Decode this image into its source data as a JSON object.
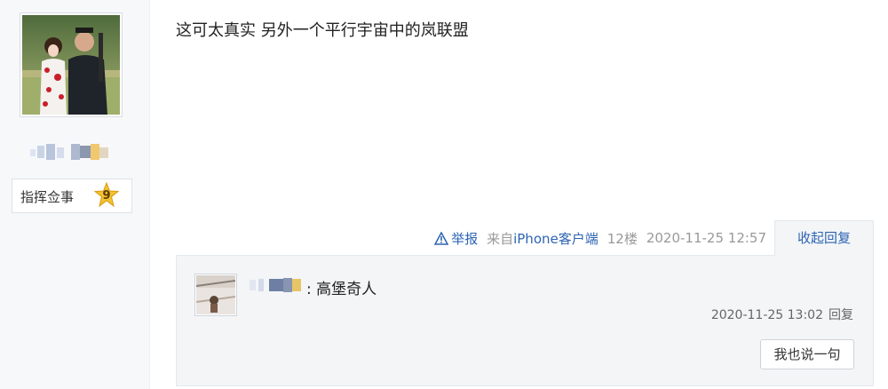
{
  "author": {
    "avatar_icon": "user-avatar-photo",
    "level_title": "指挥佥事",
    "level_number": "9",
    "badge_color": "#f2c230"
  },
  "post": {
    "content": "这可太真实 另外一个平行宇宙中的岚联盟",
    "tail": {
      "report_label": "举报",
      "report_icon": "warning-triangle-icon",
      "client_prefix": "来自",
      "client_name": "iPhone客户端",
      "floor": "12楼",
      "timestamp": "2020-11-25 12:57",
      "collapse_label": "收起回复"
    }
  },
  "replies": [
    {
      "avatar_icon": "reply-user-avatar",
      "separator": ": ",
      "text": "高堡奇人",
      "timestamp": "2020-11-25 13:02",
      "reply_label": "回复"
    }
  ],
  "reply_box": {
    "say_button_label": "我也说一句"
  },
  "colors": {
    "link": "#2d64b3",
    "meta": "#999999",
    "reply_bg": "#f3f5f7"
  }
}
